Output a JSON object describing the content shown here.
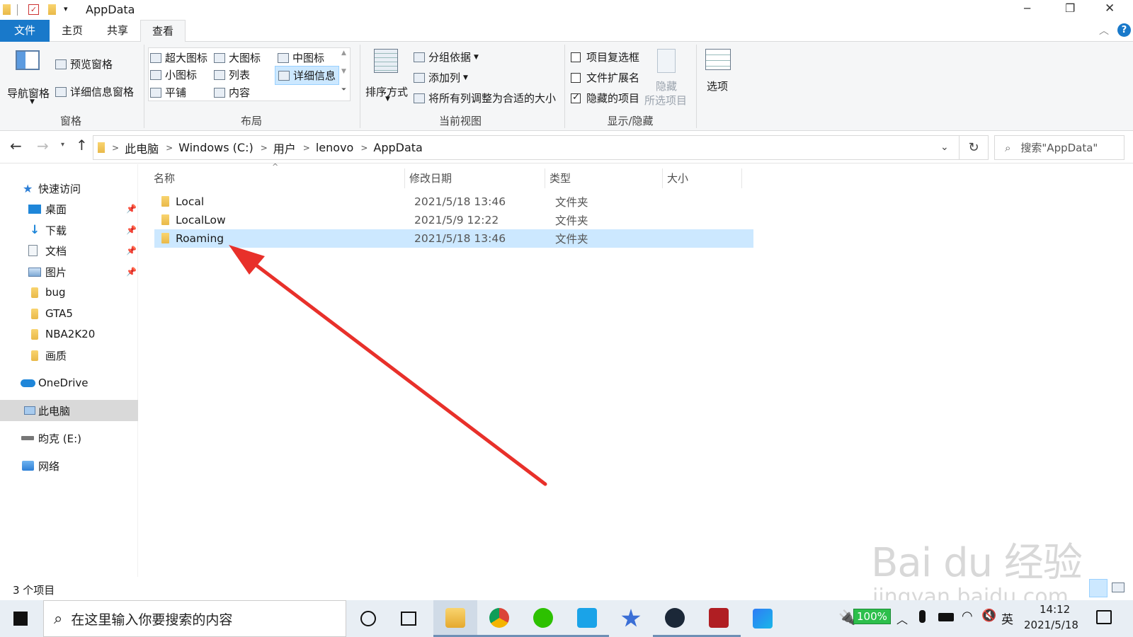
{
  "window": {
    "title": "AppData",
    "controls": {
      "minimize": "─",
      "restore": "❐",
      "close": "✕"
    }
  },
  "ribbon_tabs": [
    {
      "label": "文件"
    },
    {
      "label": "主页"
    },
    {
      "label": "共享"
    },
    {
      "label": "查看"
    }
  ],
  "ribbon": {
    "panes": {
      "nav_pane": "导航窗格",
      "preview_pane": "预览窗格",
      "details_pane": "详细信息窗格",
      "group_label": "窗格"
    },
    "layout": {
      "extra_large": "超大图标",
      "large": "大图标",
      "medium": "中图标",
      "small": "小图标",
      "list": "列表",
      "details": "详细信息",
      "tiles": "平铺",
      "content": "内容",
      "group_label": "布局"
    },
    "current_view": {
      "sort_by": "排序方式",
      "group_by": "分组依据",
      "add_column": "添加列",
      "fit_columns": "将所有列调整为合适的大小",
      "group_label": "当前视图"
    },
    "show_hide": {
      "item_checkboxes": "项目复选框",
      "item_checkboxes_checked": false,
      "file_ext": "文件扩展名",
      "file_ext_checked": false,
      "hidden_items": "隐藏的项目",
      "hidden_items_checked": true,
      "hide_selected_1": "隐藏",
      "hide_selected_2": "所选项目",
      "group_label": "显示/隐藏"
    },
    "options": "选项"
  },
  "address": {
    "crumbs": [
      "此电脑",
      "Windows (C:)",
      "用户",
      "lenovo",
      "AppData"
    ],
    "search_placeholder": "搜索\"AppData\""
  },
  "nav": {
    "quick_access": "快速访问",
    "items": [
      {
        "label": "桌面",
        "pinned": true
      },
      {
        "label": "下载",
        "pinned": true
      },
      {
        "label": "文档",
        "pinned": true
      },
      {
        "label": "图片",
        "pinned": true
      },
      {
        "label": "bug",
        "pinned": false
      },
      {
        "label": "GTA5",
        "pinned": false
      },
      {
        "label": "NBA2K20",
        "pinned": false
      },
      {
        "label": "画质",
        "pinned": false
      }
    ],
    "onedrive": "OneDrive",
    "this_pc": "此电脑",
    "drive_e": "昀克 (E:)",
    "network": "网络"
  },
  "columns": {
    "name": "名称",
    "modified": "修改日期",
    "type": "类型",
    "size": "大小"
  },
  "files": [
    {
      "name": "Local",
      "modified": "2021/5/18 13:46",
      "type": "文件夹",
      "selected": false
    },
    {
      "name": "LocalLow",
      "modified": "2021/5/9 12:22",
      "type": "文件夹",
      "selected": false
    },
    {
      "name": "Roaming",
      "modified": "2021/5/18 13:46",
      "type": "文件夹",
      "selected": true
    }
  ],
  "status": {
    "count": "3 个项目"
  },
  "taskbar": {
    "search_placeholder": "在这里输入你要搜索的内容",
    "battery": "100%",
    "ime": "英",
    "time": "14:12",
    "date": "2021/5/18"
  },
  "watermark": {
    "brand": "Bai du 经验",
    "url": "jingyan.baidu.com"
  },
  "colors": {
    "accent": "#1979ca",
    "selection": "#cce8ff",
    "arrow": "#e8302a"
  }
}
